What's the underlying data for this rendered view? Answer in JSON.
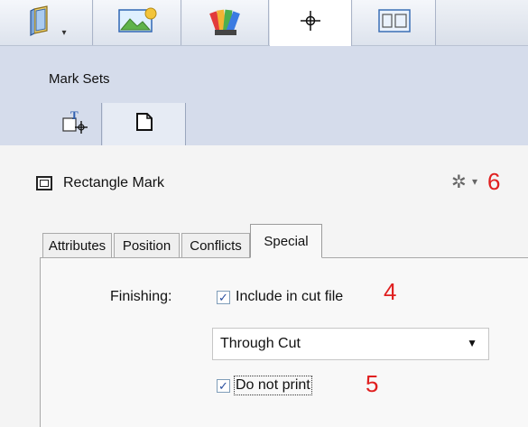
{
  "toolbar": {
    "tabs": [
      {
        "icon": "book-icon",
        "has_dropdown": true
      },
      {
        "icon": "image-icon"
      },
      {
        "icon": "color-swatches-icon"
      },
      {
        "icon": "crosshair-icon",
        "selected": true
      },
      {
        "icon": "layout-icon"
      }
    ]
  },
  "mark_sets": {
    "label": "Mark Sets",
    "buttons": [
      {
        "icon": "text-mark-icon"
      },
      {
        "icon": "page-icon",
        "selected": true
      }
    ]
  },
  "mark": {
    "title": "Rectangle Mark",
    "settings_icon": "gear-icon",
    "annotation": "6"
  },
  "tabs": [
    {
      "label": "Attributes"
    },
    {
      "label": "Position"
    },
    {
      "label": "Conflicts"
    },
    {
      "label": "Special",
      "selected": true
    }
  ],
  "special": {
    "finishing_label": "Finishing:",
    "include_cut": {
      "label": "Include in cut file",
      "checked": true,
      "annotation": "4"
    },
    "cut_type": {
      "value": "Through Cut"
    },
    "do_not_print": {
      "label": "Do not print",
      "checked": true,
      "annotation": "5"
    }
  },
  "colors": {
    "annotation": "#e02020",
    "panel_bg": "#d5dceb"
  }
}
